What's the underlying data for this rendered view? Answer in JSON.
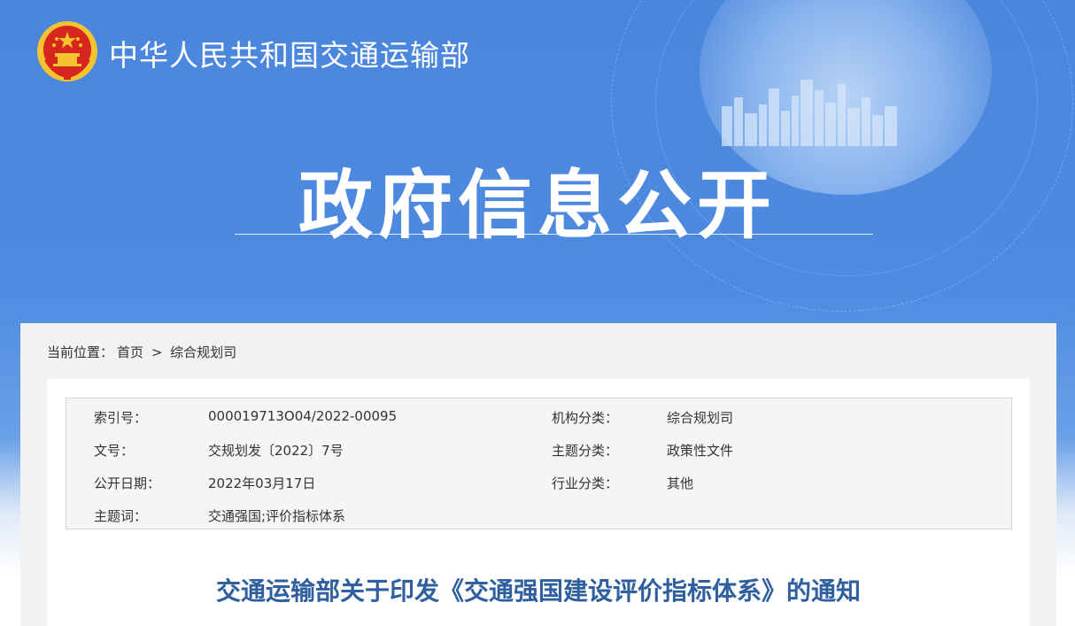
{
  "header": {
    "ministry_name": "中华人民共和国交通运输部",
    "section_title": "政府信息公开"
  },
  "breadcrumb": {
    "label": "当前位置：",
    "home": "首页",
    "separator": ">",
    "current": "综合规划司"
  },
  "meta": {
    "index_label": "索引号：",
    "index_value": "000019713O04/2022-00095",
    "org_label": "机构分类：",
    "org_value": "综合规划司",
    "doc_no_label": "文号：",
    "doc_no_value": "交规划发〔2022〕7号",
    "topic_label": "主题分类：",
    "topic_value": "政策性文件",
    "date_label": "公开日期：",
    "date_value": "2022年03月17日",
    "industry_label": "行业分类：",
    "industry_value": "其他",
    "keywords_label": "主题词：",
    "keywords_value": "交通强国;评价指标体系"
  },
  "document": {
    "title": "交通运输部关于印发《交通强国建设评价指标体系》的通知"
  },
  "colors": {
    "banner_blue": "#4a86dc",
    "title_blue": "#2f5f9e",
    "emblem_red": "#d7261e",
    "emblem_gold": "#f5c230"
  }
}
